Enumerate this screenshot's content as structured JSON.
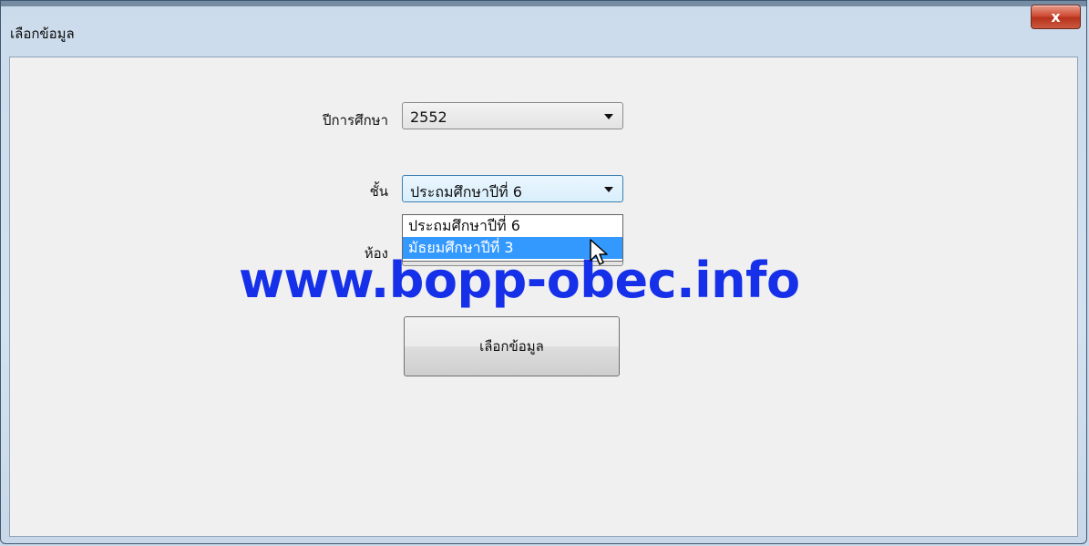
{
  "window": {
    "title": "เลือกข้อมูล",
    "close_label": "x"
  },
  "form": {
    "year_label": "ปีการศึกษา",
    "year_value": "2552",
    "class_label": "ชั้น",
    "class_value": "ประถมศึกษาปีที่ 6",
    "room_label": "ห้อง",
    "class_options": [
      "ประถมศึกษาปีที่ 6",
      "มัธยมศึกษาปีที่ 3"
    ],
    "submit_label": "เลือกข้อมูล"
  },
  "watermark": "www.bopp-obec.info",
  "colors": {
    "selection": "#3399ff",
    "watermark": "#1530e8",
    "close": "#c9442b"
  }
}
